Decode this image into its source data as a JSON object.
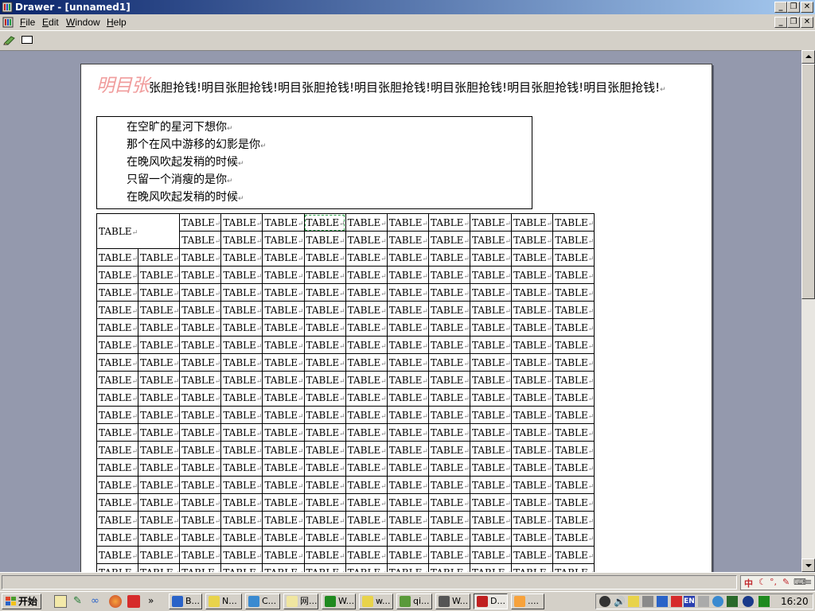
{
  "window": {
    "title": "Drawer - [unnamed1]"
  },
  "menu": [
    {
      "letter": "F",
      "rest": "ile"
    },
    {
      "letter": "E",
      "rest": "dit"
    },
    {
      "letter": "W",
      "rest": "indow"
    },
    {
      "letter": "H",
      "rest": "elp"
    }
  ],
  "document": {
    "heading_big": "明目张",
    "heading_rest": "张胆抢钱!明目张胆抢钱!明目张胆抢钱!明目张胆抢钱!明目张胆抢钱!明目张胆抢钱!明目张胆抢钱!",
    "poem": [
      "在空旷的星河下想你",
      "那个在风中游移的幻影是你",
      "在晚风吹起发稍的时候",
      "只留一个消瘦的是你",
      "在晚风吹起发稍的时候"
    ],
    "paragraph_mark": "↵",
    "table": {
      "cell_text": "TABLE",
      "merged_cell_text": "TABLE",
      "columns": 12,
      "rows": 21
    }
  },
  "taskbar": {
    "start_label": "开始",
    "tasks": [
      "B...",
      "N...",
      "C...",
      "网...",
      "W...",
      "w...",
      "qi...",
      "W...",
      "D...",
      "...."
    ],
    "clock": "16:20",
    "tray_lang": "EN"
  },
  "ime": {
    "label": "中"
  },
  "colors": {
    "titlebar_start": "#0a246a",
    "titlebar_end": "#a6caf0",
    "workspace": "#9499ad",
    "heading_big": "#f09c9c",
    "selected_cell_outline": "#2ea34a"
  }
}
